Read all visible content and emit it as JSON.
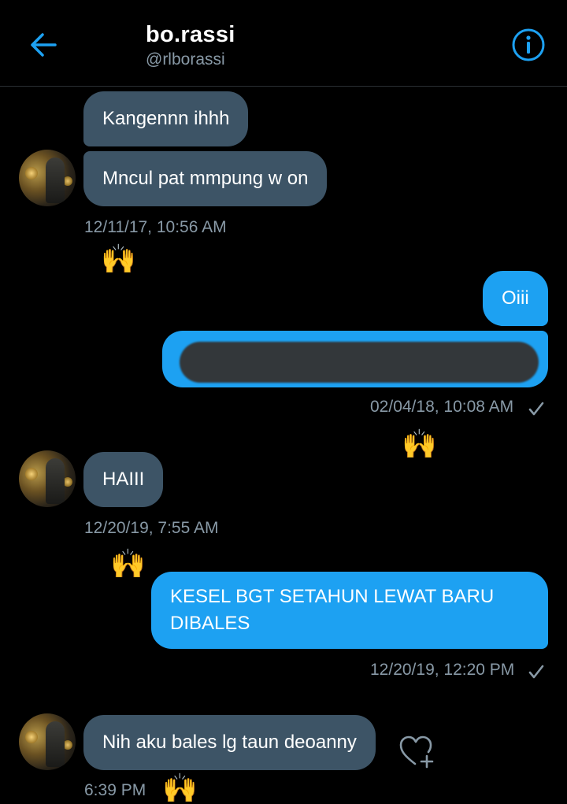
{
  "header": {
    "title": "bo.rassi",
    "handle": "@rlborassi",
    "back_icon": "arrow-left-icon",
    "info_icon": "info-circle-icon"
  },
  "colors": {
    "accent": "#1da1f2",
    "incoming_bubble": "#3d5466",
    "background": "#000000",
    "muted_text": "#8899a6"
  },
  "messages": [
    {
      "direction": "incoming",
      "text": "Kangennn ihhh"
    },
    {
      "direction": "incoming",
      "text": "Mncul pat mmpung w on",
      "timestamp": "12/11/17, 10:56 AM",
      "reaction": "🙌"
    },
    {
      "direction": "outgoing",
      "text": "Oiii"
    },
    {
      "direction": "outgoing",
      "text": "",
      "redacted": true,
      "timestamp": "02/04/18, 10:08 AM",
      "reaction": "🙌"
    },
    {
      "direction": "incoming",
      "text": "HAIII",
      "timestamp": "12/20/19, 7:55 AM",
      "reaction": "🙌"
    },
    {
      "direction": "outgoing",
      "text": "KESEL BGT SETAHUN LEWAT BARU DIBALES",
      "timestamp": "12/20/19, 12:20 PM"
    },
    {
      "direction": "incoming",
      "text": "Nih aku bales lg taun deoanny",
      "timestamp": "6:39 PM",
      "reaction": "🙌"
    }
  ],
  "icons": {
    "read_check": "check-icon",
    "add_reaction": "heart-plus-icon"
  }
}
